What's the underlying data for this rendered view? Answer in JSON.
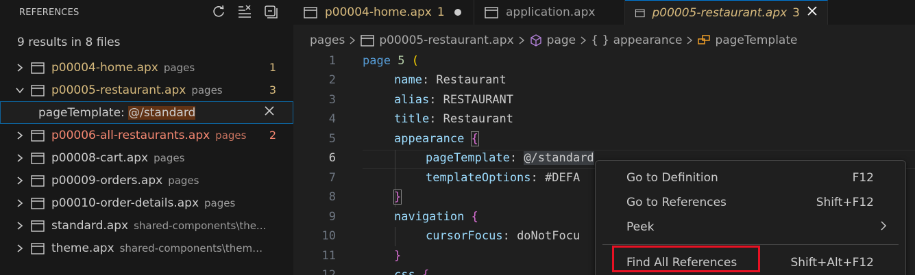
{
  "references_panel": {
    "title": "REFERENCES",
    "summary": "9 results in 8 files",
    "files": [
      {
        "name": "p00004-home.apx",
        "path": "pages",
        "count": "1",
        "state": "mod",
        "expanded": false
      },
      {
        "name": "p00005-restaurant.apx",
        "path": "pages",
        "count": "3",
        "state": "mod",
        "expanded": true
      },
      {
        "name": "p00006-all-restaurants.apx",
        "path": "pages",
        "count": "2",
        "state": "err",
        "expanded": false
      },
      {
        "name": "p00008-cart.apx",
        "path": "pages",
        "count": "",
        "state": "normal",
        "expanded": false
      },
      {
        "name": "p00009-orders.apx",
        "path": "pages",
        "count": "",
        "state": "normal",
        "expanded": false
      },
      {
        "name": "p00010-order-details.apx",
        "path": "pages",
        "count": "",
        "state": "normal",
        "expanded": false
      },
      {
        "name": "standard.apx",
        "path": "shared-components\\the...",
        "count": "",
        "state": "normal",
        "expanded": false
      },
      {
        "name": "theme.apx",
        "path": "shared-components\\themes...",
        "count": "",
        "state": "normal",
        "expanded": false
      }
    ],
    "selected_result": {
      "prefix": "pageTemplate: ",
      "match": "@/standard"
    }
  },
  "tabs": [
    {
      "label": "p00004-home.apx",
      "badge": "1",
      "dirty": true
    },
    {
      "label": "application.apx",
      "badge": "",
      "dirty": false
    },
    {
      "label": "p00005-restaurant.apx",
      "badge": "3",
      "active": true
    }
  ],
  "breadcrumb": [
    "pages",
    "p00005-restaurant.apx",
    "page",
    "{ } appearance",
    "pageTemplate"
  ],
  "code": {
    "line_numbers": [
      "1",
      "2",
      "3",
      "4",
      "5",
      "6",
      "7",
      "8",
      "9",
      "10",
      "11",
      "12"
    ],
    "current_line": "6",
    "l1_kw": "page",
    "l1_num": "5",
    "l1_open": "(",
    "l2_key": "name",
    "l2_val": ": Restaurant",
    "l3_key": "alias",
    "l3_val": ": RESTAURANT",
    "l4_key": "title",
    "l4_val": ": Restaurant",
    "l5_key": "appearance",
    "l5_open": "{",
    "l6_key": "pageTemplate",
    "l6_colon": ": ",
    "l6_val": "@/standard",
    "l7_key": "templateOptions",
    "l7_val": ": #DEFA",
    "l8_close": "}",
    "l9_key": "navigation",
    "l9_open": "{",
    "l10_key": "cursorFocus",
    "l10_val": ": doNotFocu",
    "l11_close": "}",
    "l12_key": "css",
    "l12_open": "{"
  },
  "context_menu": {
    "items": [
      {
        "label": "Go to Definition",
        "shortcut": "F12"
      },
      {
        "label": "Go to References",
        "shortcut": "Shift+F12"
      },
      {
        "label": "Peek",
        "shortcut": ""
      },
      {
        "label": "Find All References",
        "shortcut": "Shift+Alt+F12"
      }
    ]
  },
  "colors": {
    "accent": "#0078d4",
    "highlight_box": "#e81123",
    "modified": "#d7ba7d",
    "error": "#f48771"
  }
}
